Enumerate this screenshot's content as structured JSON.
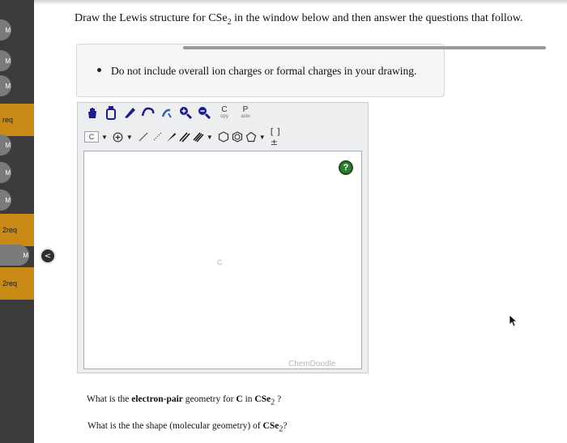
{
  "nav": {
    "items": [
      {
        "label": "M"
      },
      {
        "label": "M"
      },
      {
        "label": "M"
      },
      {
        "label": "req"
      },
      {
        "label": "M"
      },
      {
        "label": "M"
      },
      {
        "label": "M"
      },
      {
        "label": "2req"
      },
      {
        "label": "M"
      },
      {
        "label": "2req"
      }
    ],
    "collapse_label": "<"
  },
  "question": {
    "prompt_pre": "Draw the Lewis structure for CSe",
    "prompt_sub": "2",
    "prompt_post": " in the window below and then answer the questions that follow.",
    "instruction": "Do not include overall ion charges or formal charges in your drawing."
  },
  "editor": {
    "copy_label": "C",
    "copy_sub": "opy",
    "paste_label": "P",
    "paste_sub": "aste",
    "element_button": "C",
    "bracket_label": "[ ]±",
    "canvas_atom": "C",
    "watermark": "ChemDoodle",
    "help_label": "?",
    "icons": [
      "hand-icon",
      "eraser-icon",
      "single-bond-icon",
      "lasso-icon",
      "ring-icon",
      "zoom-in-icon",
      "zoom-out-icon",
      "add-atom-icon",
      "single-bond-line-icon",
      "hashed-bond-icon",
      "wedge-bond-icon",
      "double-bond-icon",
      "triple-bond-icon",
      "benzene-icon",
      "hexagon-icon",
      "pentagon-icon"
    ],
    "accent_color": "#1c1c8c",
    "help_color": "#2e7d32"
  },
  "questions": [
    {
      "pre": "What is the ",
      "bold": "electron-pair",
      "mid": " geometry for ",
      "bold2": "C",
      "mid2": " in ",
      "bold3": "CSe",
      "sub": "2",
      "post": " ?"
    },
    {
      "pre": "What is the the shape (molecular geometry) of ",
      "bold": "CSe",
      "sub": "2",
      "post": "?"
    }
  ]
}
